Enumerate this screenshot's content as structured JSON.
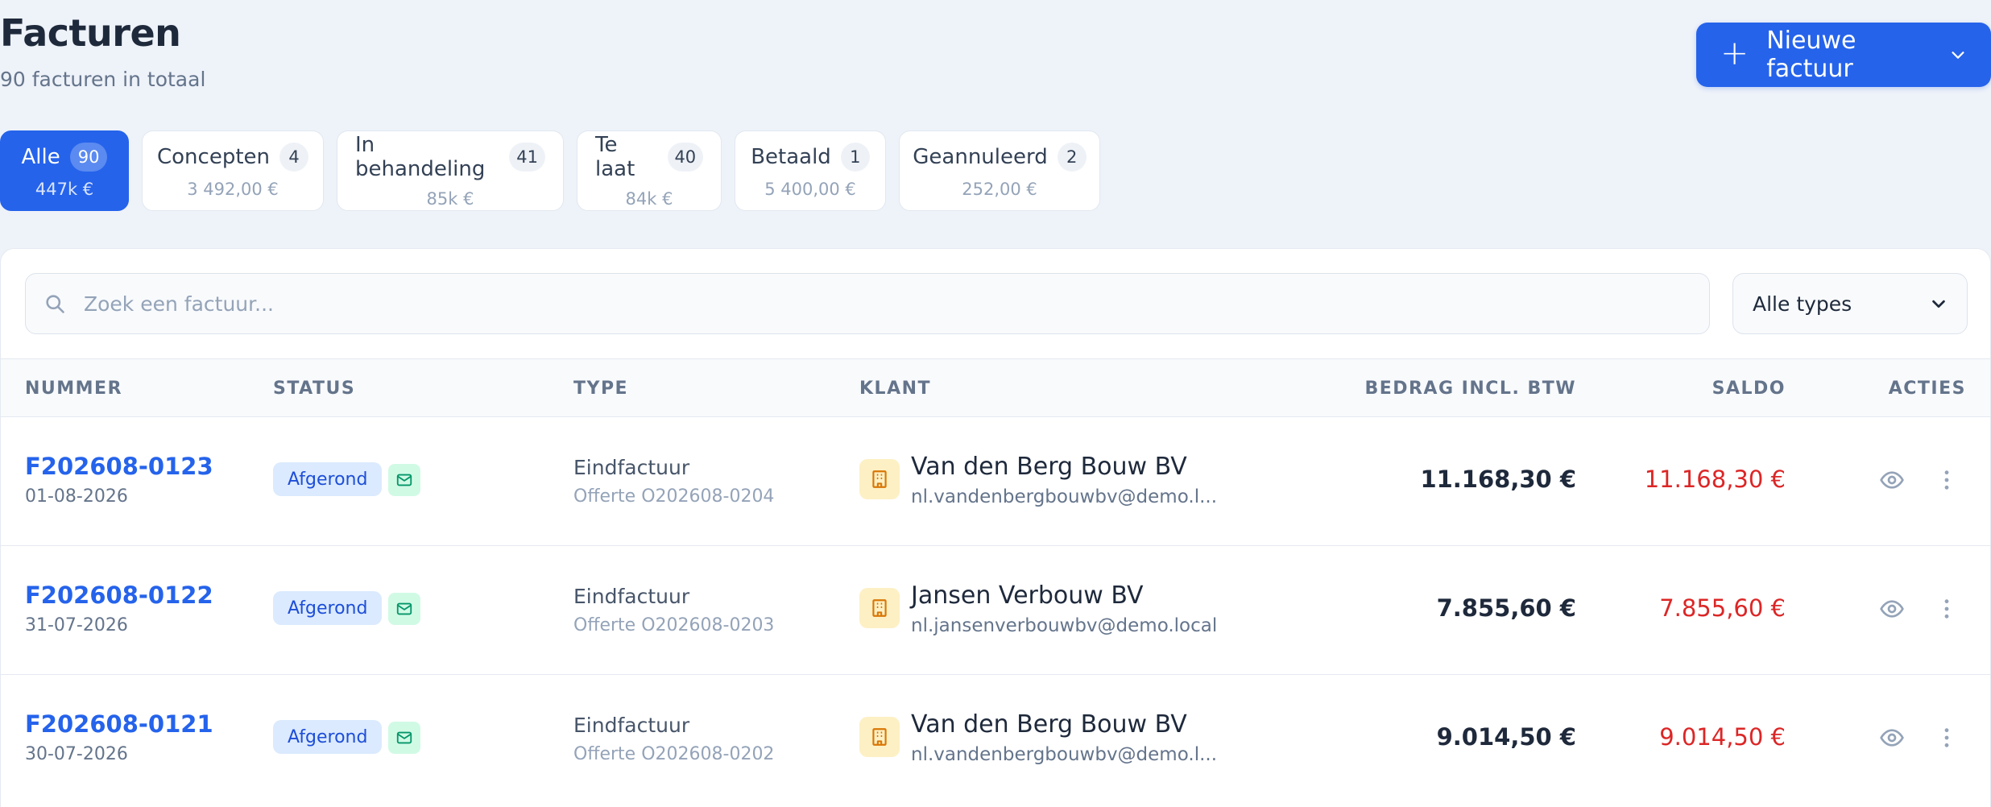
{
  "header": {
    "title": "Facturen",
    "subtitle": "90 facturen in totaal",
    "new_button_label": "Nieuwe factuur"
  },
  "tabs": [
    {
      "label": "Alle",
      "count": "90",
      "amount": "447k €",
      "active": true
    },
    {
      "label": "Concepten",
      "count": "4",
      "amount": "3 492,00 €"
    },
    {
      "label": "In behandeling",
      "count": "41",
      "amount": "85k €"
    },
    {
      "label": "Te laat",
      "count": "40",
      "amount": "84k €"
    },
    {
      "label": "Betaald",
      "count": "1",
      "amount": "5 400,00 €"
    },
    {
      "label": "Geannuleerd",
      "count": "2",
      "amount": "252,00 €"
    }
  ],
  "search": {
    "placeholder": "Zoek een factuur...",
    "value": ""
  },
  "type_filter": {
    "selected": "Alle types"
  },
  "columns": {
    "number": "NUMMER",
    "status": "STATUS",
    "type": "TYPE",
    "client": "KLANT",
    "amount": "BEDRAG INCL. BTW",
    "balance": "SALDO",
    "actions": "ACTIES"
  },
  "rows": [
    {
      "number": "F202608-0123",
      "date": "01-08-2026",
      "status": "Afgerond",
      "type": "Eindfactuur",
      "quote": "Offerte O202608-0204",
      "client_name": "Van den Berg Bouw BV",
      "client_email": "nl.vandenbergbouwbv@demo.l...",
      "amount": "11.168,30 €",
      "balance": "11.168,30 €"
    },
    {
      "number": "F202608-0122",
      "date": "31-07-2026",
      "status": "Afgerond",
      "type": "Eindfactuur",
      "quote": "Offerte O202608-0203",
      "client_name": "Jansen Verbouw BV",
      "client_email": "nl.jansenverbouwbv@demo.local",
      "amount": "7.855,60 €",
      "balance": "7.855,60 €"
    },
    {
      "number": "F202608-0121",
      "date": "30-07-2026",
      "status": "Afgerond",
      "type": "Eindfactuur",
      "quote": "Offerte O202608-0202",
      "client_name": "Van den Berg Bouw BV",
      "client_email": "nl.vandenbergbouwbv@demo.l...",
      "amount": "9.014,50 €",
      "balance": "9.014,50 €"
    }
  ],
  "colors": {
    "accent": "#2563eb",
    "balance_due": "#dc2626",
    "status_badge_bg": "#dbeafe",
    "mail_badge_bg": "#d1fae5",
    "client_icon_bg": "#fdf0c4"
  },
  "icons": {
    "new_button": "plus-icon",
    "new_button_menu": "chevron-down-icon",
    "search": "search-icon",
    "select": "chevron-down-icon",
    "mail_status": "mail-icon",
    "client": "building-icon",
    "view_action": "eye-icon",
    "more_action": "more-vertical-icon"
  }
}
